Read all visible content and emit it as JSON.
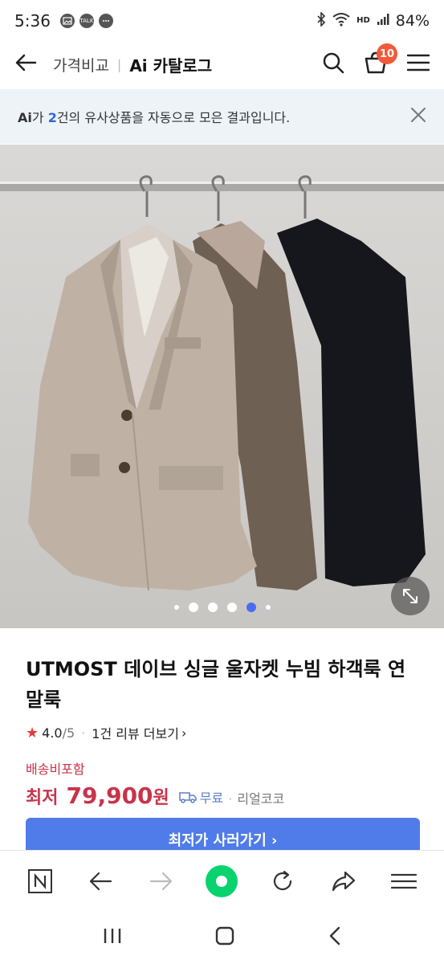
{
  "status": {
    "time": "5:36",
    "talk_label": "TALK",
    "signal_label": "HD",
    "battery": "84%"
  },
  "header": {
    "crumb": "가격비교",
    "title": "Ai 카탈로그",
    "cart_count": "10"
  },
  "banner": {
    "ai": "Ai",
    "text_before": "가 ",
    "count": "2",
    "text_after": "건의 유사상품을 자동으로 모은 결과입니다."
  },
  "gallery": {
    "total_dots": 6,
    "active_index": 4
  },
  "product": {
    "title": "UTMOST 데이브 싱글 울자켓 누빔 하객룩 연말룩",
    "rating": "4.0",
    "rating_max": "/5",
    "reviews": "1건 리뷰 더보기",
    "shipping_note": "배송비포함",
    "price_label": "최저",
    "price": "79,900",
    "price_unit": "원",
    "delivery": "무료",
    "store": "리얼코코"
  },
  "cta": {
    "label": "최저가 사러가기 ›"
  },
  "colors": {
    "accent": "#4f7ce8",
    "price": "#c8334a",
    "badge": "#f25a3a",
    "banner_bg": "#eef3f8"
  }
}
